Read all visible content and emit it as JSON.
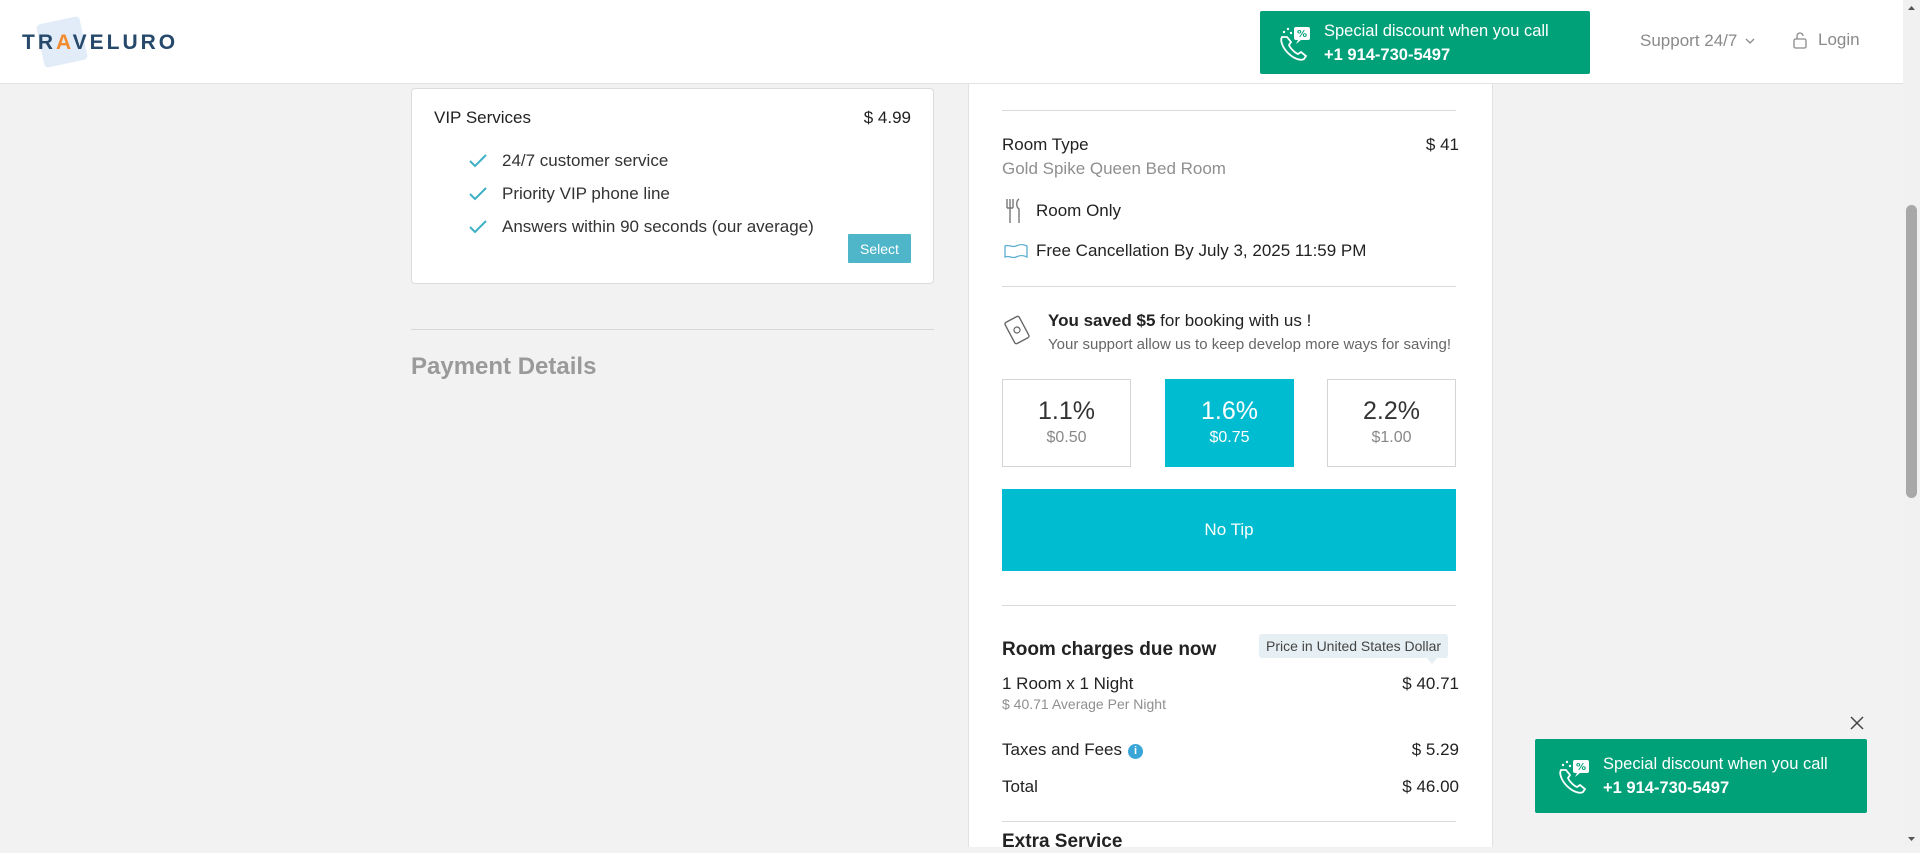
{
  "header": {
    "logo_text_pre": "TR",
    "logo_text_accent": "A",
    "logo_text_post": "VELURO",
    "promo_text": "Special discount when you call",
    "promo_phone": "+1 914-730-5497",
    "support_label": "Support 24/7",
    "login_label": "Login"
  },
  "vip": {
    "title": "VIP Services",
    "price": "$ 4.99",
    "features": [
      "24/7 customer service",
      "Priority VIP phone line",
      "Answers within 90 seconds (our average)"
    ],
    "select_label": "Select"
  },
  "payment": {
    "title": "Payment Details"
  },
  "summary": {
    "room_type_label": "Room Type",
    "room_type_price": "$ 41",
    "room_name": "Gold Spike Queen Bed Room",
    "meal": "Room Only",
    "cancellation": "Free Cancellation By July 3, 2025 11:59 PM",
    "saved_bold": "You saved $5",
    "saved_rest": "for booking with us !",
    "saved_sub": "Your support allow us to keep develop more ways for saving!",
    "tips": [
      {
        "pct": "1.1%",
        "amt": "$0.50",
        "active": false
      },
      {
        "pct": "1.6%",
        "amt": "$0.75",
        "active": true
      },
      {
        "pct": "2.2%",
        "amt": "$1.00",
        "active": false
      }
    ],
    "no_tip_label": "No Tip",
    "charges_title": "Room charges due now",
    "currency_badge": "Price in United States Dollar",
    "rooms_nights": "1 Room x 1 Night",
    "rooms_price": "$ 40.71",
    "avg_per_night": "$ 40.71 Average Per Night",
    "taxes_label": "Taxes and Fees",
    "taxes_price": "$ 5.29",
    "total_label": "Total",
    "total_price": "$ 46.00",
    "extra_title": "Extra Service"
  },
  "colors": {
    "promo_green": "#00a179",
    "accent_teal": "#00bcd0",
    "select_blue": "#4fb6c9",
    "logo_navy": "#26496b",
    "logo_orange": "#f28a2e"
  }
}
